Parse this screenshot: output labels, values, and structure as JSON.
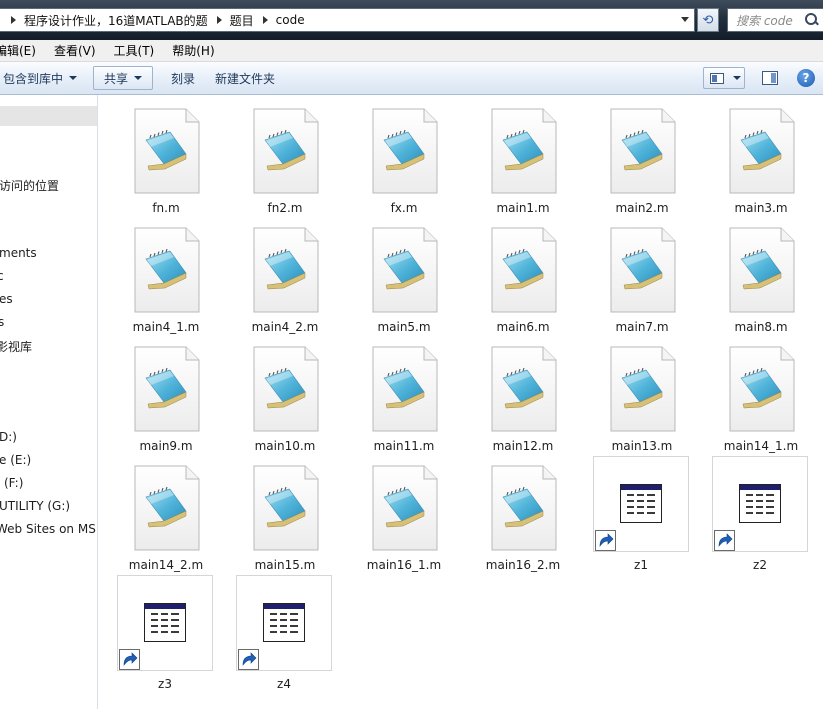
{
  "address": {
    "crumbs": [
      "程序设计作业，16道MATLAB的题",
      "题目",
      "code"
    ]
  },
  "search": {
    "placeholder": "搜索 code"
  },
  "menu": [
    "编辑(E)",
    "查看(V)",
    "工具(T)",
    "帮助(H)"
  ],
  "toolbar": {
    "include_library": "包含到库中",
    "share": "共享",
    "burn": "刻录",
    "new_folder": "新建文件夹"
  },
  "nav": [
    "访问的位置",
    "ments",
    "c",
    "es",
    "s",
    "影视库",
    "D:)",
    "e (E:)",
    "(F:)",
    "UTILITY (G:)",
    "Web Sites on MSN"
  ],
  "files": [
    {
      "name": "fn.m",
      "type": "script"
    },
    {
      "name": "fn2.m",
      "type": "script"
    },
    {
      "name": "fx.m",
      "type": "script"
    },
    {
      "name": "main1.m",
      "type": "script"
    },
    {
      "name": "main2.m",
      "type": "script"
    },
    {
      "name": "main3.m",
      "type": "script"
    },
    {
      "name": "main4_1.m",
      "type": "script"
    },
    {
      "name": "main4_2.m",
      "type": "script"
    },
    {
      "name": "main5.m",
      "type": "script"
    },
    {
      "name": "main6.m",
      "type": "script"
    },
    {
      "name": "main7.m",
      "type": "script"
    },
    {
      "name": "main8.m",
      "type": "script"
    },
    {
      "name": "main9.m",
      "type": "script"
    },
    {
      "name": "main10.m",
      "type": "script"
    },
    {
      "name": "main11.m",
      "type": "script"
    },
    {
      "name": "main12.m",
      "type": "script"
    },
    {
      "name": "main13.m",
      "type": "script"
    },
    {
      "name": "main14_1.m",
      "type": "script"
    },
    {
      "name": "main14_2.m",
      "type": "script"
    },
    {
      "name": "main15.m",
      "type": "script"
    },
    {
      "name": "main16_1.m",
      "type": "script"
    },
    {
      "name": "main16_2.m",
      "type": "script"
    },
    {
      "name": "z1",
      "type": "shortcut"
    },
    {
      "name": "z2",
      "type": "shortcut"
    },
    {
      "name": "z3",
      "type": "shortcut"
    },
    {
      "name": "z4",
      "type": "shortcut"
    }
  ],
  "colors": {
    "addressbar_dark": "#131d29",
    "toolbar_text": "#1e395b",
    "notepad_blue": "#4fb3d9",
    "shortcut_header": "#1f1f6e"
  }
}
